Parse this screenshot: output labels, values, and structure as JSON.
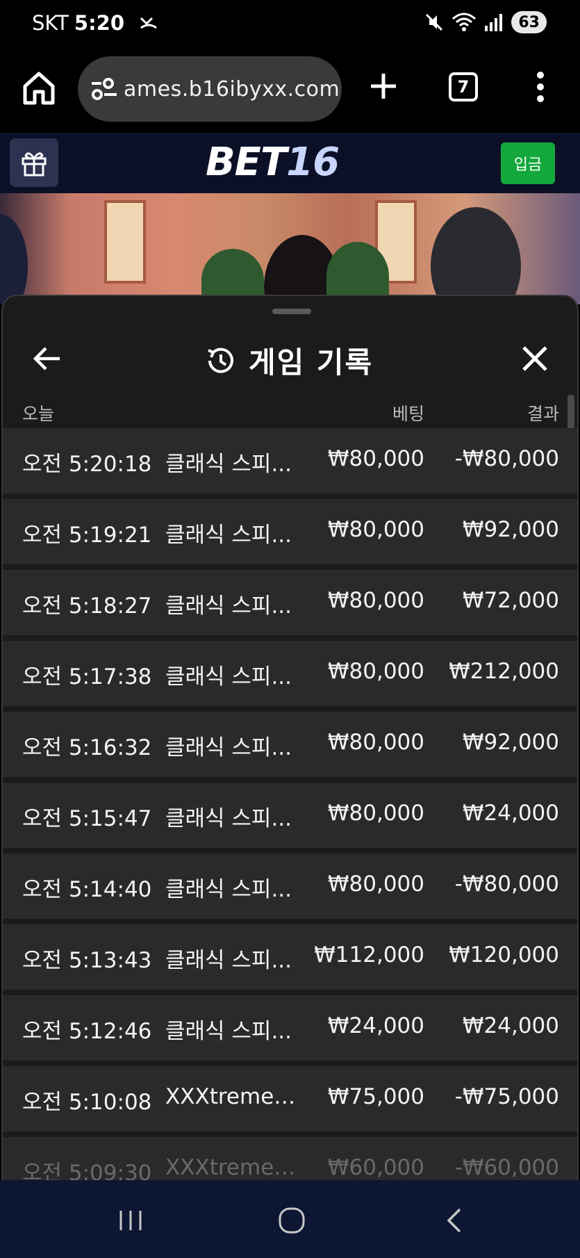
{
  "status_bar": {
    "carrier": "SKT",
    "time": "5:20",
    "battery": "63"
  },
  "browser": {
    "url": "ames.b16ibyxx.com",
    "tab_count": "7"
  },
  "site": {
    "logo_part1": "BET",
    "logo_part2": "16",
    "deposit_label": "입금"
  },
  "sheet": {
    "title": "게임 기록",
    "col_date": "오늘",
    "col_bet": "베팅",
    "col_result": "결과",
    "rows": [
      {
        "time": "오전 5:20:18",
        "game": "클래식 스피...",
        "bet": "₩80,000",
        "result": "-₩80,000"
      },
      {
        "time": "오전 5:19:21",
        "game": "클래식 스피...",
        "bet": "₩80,000",
        "result": "₩92,000"
      },
      {
        "time": "오전 5:18:27",
        "game": "클래식 스피...",
        "bet": "₩80,000",
        "result": "₩72,000"
      },
      {
        "time": "오전 5:17:38",
        "game": "클래식 스피...",
        "bet": "₩80,000",
        "result": "₩212,000"
      },
      {
        "time": "오전 5:16:32",
        "game": "클래식 스피...",
        "bet": "₩80,000",
        "result": "₩92,000"
      },
      {
        "time": "오전 5:15:47",
        "game": "클래식 스피...",
        "bet": "₩80,000",
        "result": "₩24,000"
      },
      {
        "time": "오전 5:14:40",
        "game": "클래식 스피...",
        "bet": "₩80,000",
        "result": "-₩80,000"
      },
      {
        "time": "오전 5:13:43",
        "game": "클래식 스피...",
        "bet": "₩112,000",
        "result": "₩120,000"
      },
      {
        "time": "오전 5:12:46",
        "game": "클래식 스피...",
        "bet": "₩24,000",
        "result": "₩24,000"
      },
      {
        "time": "오전 5:10:08",
        "game": "XXXtreme ...",
        "bet": "₩75,000",
        "result": "-₩75,000"
      },
      {
        "time": "오전 5:09:30",
        "game": "XXXtreme ...",
        "bet": "₩60,000",
        "result": "-₩60,000"
      }
    ]
  },
  "icons": {
    "missed_call": "missed-call-icon",
    "mute": "mute-icon",
    "wifi": "wifi-icon",
    "signal": "signal-icon",
    "home": "home-icon",
    "site_info": "tune-icon",
    "gift": "gift-icon",
    "history": "history-icon",
    "back": "arrow-left-icon",
    "close": "close-icon"
  },
  "colors": {
    "deposit_button": "#14a83c",
    "sheet_bg": "#1b1b1b",
    "row_bg": "#2a2a2a",
    "site_header_bg": "#0b1026",
    "nav_bar_bg": "#0d1733"
  }
}
